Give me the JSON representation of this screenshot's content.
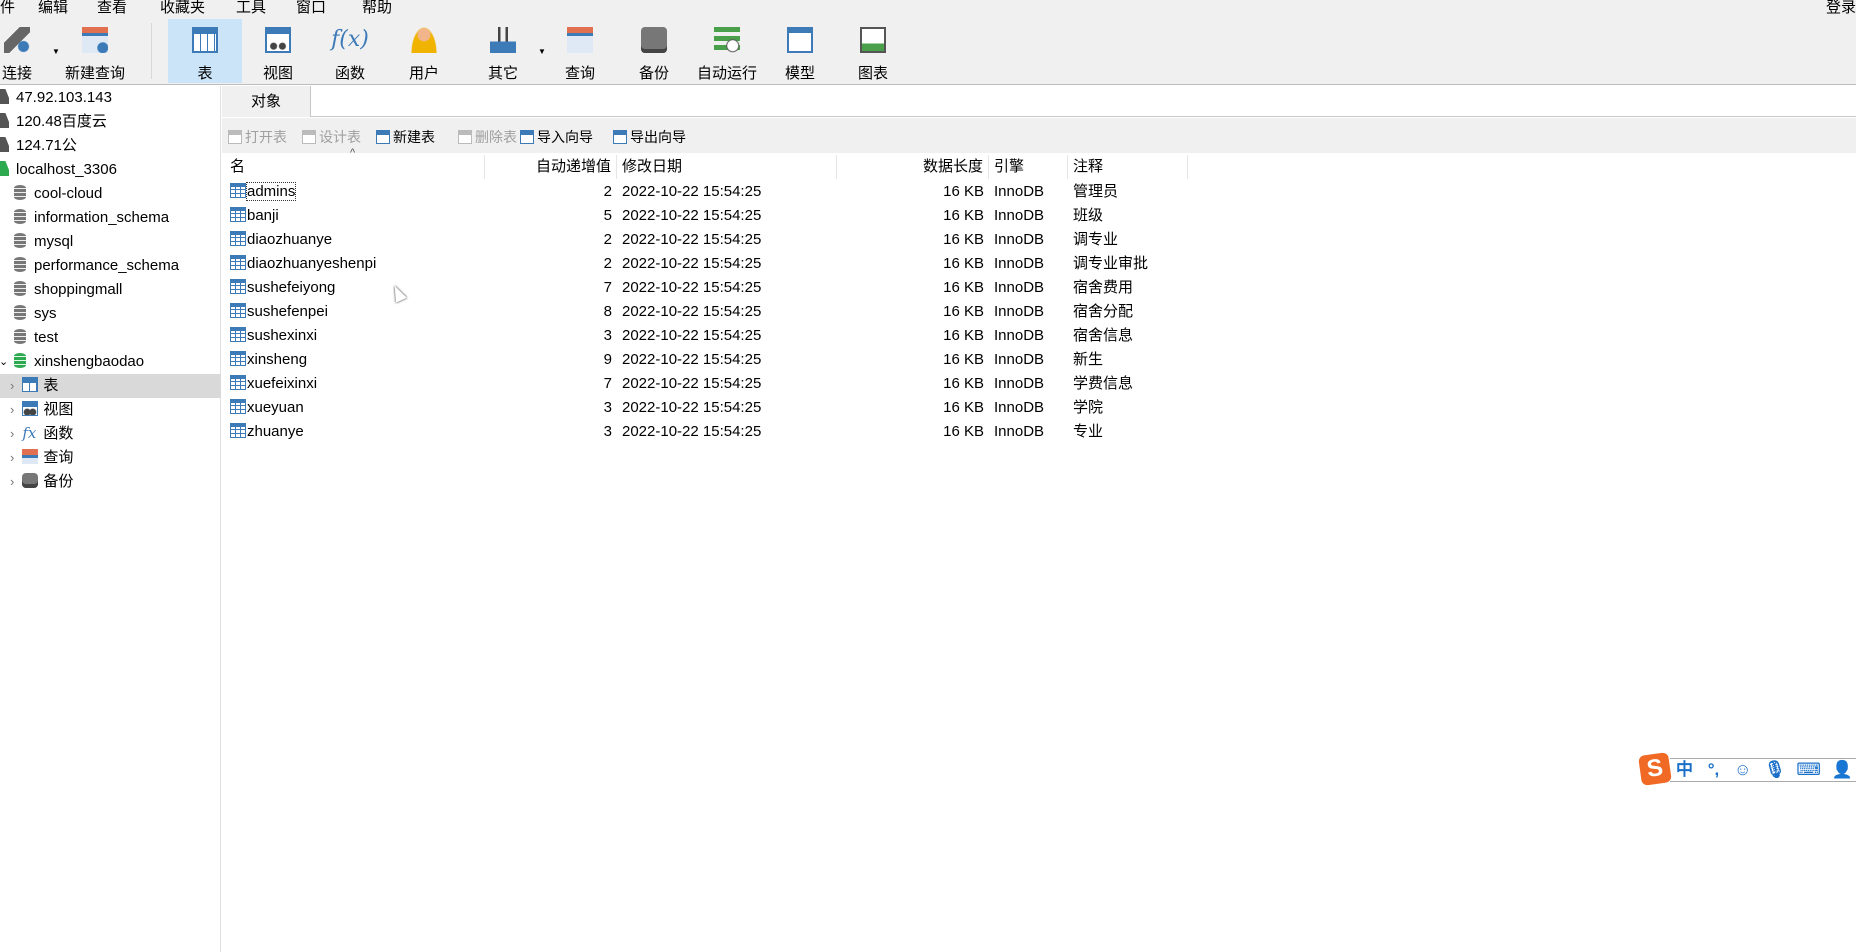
{
  "menu": [
    "件",
    "编辑",
    "查看",
    "收藏夹",
    "工具",
    "窗口",
    "帮助"
  ],
  "login": "登录",
  "toolbar": [
    {
      "label": "连接",
      "icon": "connect-plug-icon"
    },
    {
      "label": "新建查询",
      "icon": "new-query-icon"
    },
    {
      "label": "表",
      "icon": "table-icon",
      "active": true
    },
    {
      "label": "视图",
      "icon": "view-icon"
    },
    {
      "label": "函数",
      "icon": "function-icon"
    },
    {
      "label": "用户",
      "icon": "user-icon"
    },
    {
      "label": "其它",
      "icon": "tools-icon"
    },
    {
      "label": "查询",
      "icon": "query-icon"
    },
    {
      "label": "备份",
      "icon": "backup-icon"
    },
    {
      "label": "自动运行",
      "icon": "schedule-icon"
    },
    {
      "label": "模型",
      "icon": "model-icon"
    },
    {
      "label": "图表",
      "icon": "chart-icon"
    }
  ],
  "sidebar": {
    "connections": [
      "47.92.103.143",
      "120.48百度云",
      "124.71公",
      "localhost_3306"
    ],
    "databases": [
      "cool-cloud",
      "information_schema",
      "mysql",
      "performance_schema",
      "shoppingmall",
      "sys",
      "test",
      "xinshengbaodao"
    ],
    "children": [
      "表",
      "视图",
      "函数",
      "查询",
      "备份"
    ]
  },
  "tab": "对象",
  "objbar": [
    "打开表",
    "设计表",
    "新建表",
    "删除表",
    "导入向导",
    "导出向导"
  ],
  "columns": [
    "名",
    "自动递增值",
    "修改日期",
    "数据长度",
    "引擎",
    "注释"
  ],
  "rows": [
    [
      "admins",
      "2",
      "2022-10-22 15:54:25",
      "16 KB",
      "InnoDB",
      "管理员"
    ],
    [
      "banji",
      "5",
      "2022-10-22 15:54:25",
      "16 KB",
      "InnoDB",
      "班级"
    ],
    [
      "diaozhuanye",
      "2",
      "2022-10-22 15:54:25",
      "16 KB",
      "InnoDB",
      "调专业"
    ],
    [
      "diaozhuanyeshenpi",
      "2",
      "2022-10-22 15:54:25",
      "16 KB",
      "InnoDB",
      "调专业审批"
    ],
    [
      "sushefeiyong",
      "7",
      "2022-10-22 15:54:25",
      "16 KB",
      "InnoDB",
      "宿舍费用"
    ],
    [
      "sushefenpei",
      "8",
      "2022-10-22 15:54:25",
      "16 KB",
      "InnoDB",
      "宿舍分配"
    ],
    [
      "sushexinxi",
      "3",
      "2022-10-22 15:54:25",
      "16 KB",
      "InnoDB",
      "宿舍信息"
    ],
    [
      "xinsheng",
      "9",
      "2022-10-22 15:54:25",
      "16 KB",
      "InnoDB",
      "新生"
    ],
    [
      "xuefeixinxi",
      "7",
      "2022-10-22 15:54:25",
      "16 KB",
      "InnoDB",
      "学费信息"
    ],
    [
      "xueyuan",
      "3",
      "2022-10-22 15:54:25",
      "16 KB",
      "InnoDB",
      "学院"
    ],
    [
      "zhuanye",
      "3",
      "2022-10-22 15:54:25",
      "16 KB",
      "InnoDB",
      "专业"
    ]
  ],
  "ime": {
    "mode": "中",
    "punct": "°,"
  },
  "colors": {
    "accent": "#cce4f7",
    "selection": "#d9d9d9",
    "ime": "#f06a25",
    "icon": "#3d7ab8"
  }
}
